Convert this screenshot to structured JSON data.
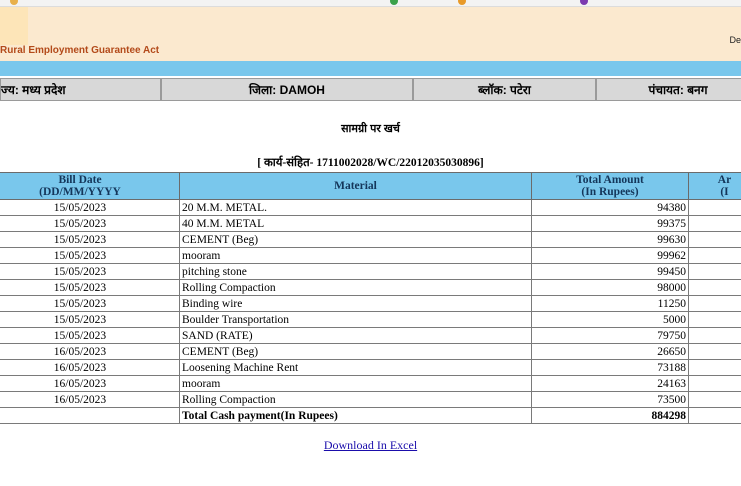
{
  "header": {
    "program_title": "Rural Employment Guarantee Act",
    "date_fragment": "De"
  },
  "location": {
    "state": "ज्य: मध्य प्रदेश",
    "district": "जिला: DAMOH",
    "block": "ब्लॉक: पटेरा",
    "panchayat": "पंचायत: बनग"
  },
  "page_title": "सामग्री पर खर्च",
  "work_code": "[ कार्य-संहित- 1711002028/WC/22012035030896]",
  "table": {
    "headers": {
      "bill_date": "Bill Date",
      "bill_date_fmt": "(DD/MM/YYYY",
      "material": "Material",
      "total_amount": "Total Amount",
      "total_amount_unit": "(In Rupees)",
      "next_col": "Ar",
      "next_col_unit": "(I"
    },
    "rows": [
      {
        "date": "15/05/2023",
        "material": "20 M.M. METAL.",
        "amount": "94380"
      },
      {
        "date": "15/05/2023",
        "material": "40 M.M. METAL",
        "amount": "99375"
      },
      {
        "date": "15/05/2023",
        "material": "CEMENT (Beg)",
        "amount": "99630"
      },
      {
        "date": "15/05/2023",
        "material": "mooram",
        "amount": "99962"
      },
      {
        "date": "15/05/2023",
        "material": "pitching stone",
        "amount": "99450"
      },
      {
        "date": "15/05/2023",
        "material": "Rolling Compaction",
        "amount": "98000"
      },
      {
        "date": "15/05/2023",
        "material": "Binding wire",
        "amount": "11250"
      },
      {
        "date": "15/05/2023",
        "material": "Boulder Transportation",
        "amount": "5000"
      },
      {
        "date": "15/05/2023",
        "material": "SAND (RATE)",
        "amount": "79750"
      },
      {
        "date": "16/05/2023",
        "material": "CEMENT (Beg)",
        "amount": "26650"
      },
      {
        "date": "16/05/2023",
        "material": "Loosening Machine Rent",
        "amount": "73188"
      },
      {
        "date": "16/05/2023",
        "material": "mooram",
        "amount": "24163"
      },
      {
        "date": "16/05/2023",
        "material": "Rolling Compaction",
        "amount": "73500"
      }
    ],
    "total_label": "Total Cash payment(In Rupees)",
    "total_amount": "884298"
  },
  "download_link": "Download In Excel",
  "colors": {
    "banner_bg": "#fbe9cf",
    "header_blue": "#79c7ec",
    "title_orange": "#b34a1a",
    "link": "#1a0dab"
  }
}
